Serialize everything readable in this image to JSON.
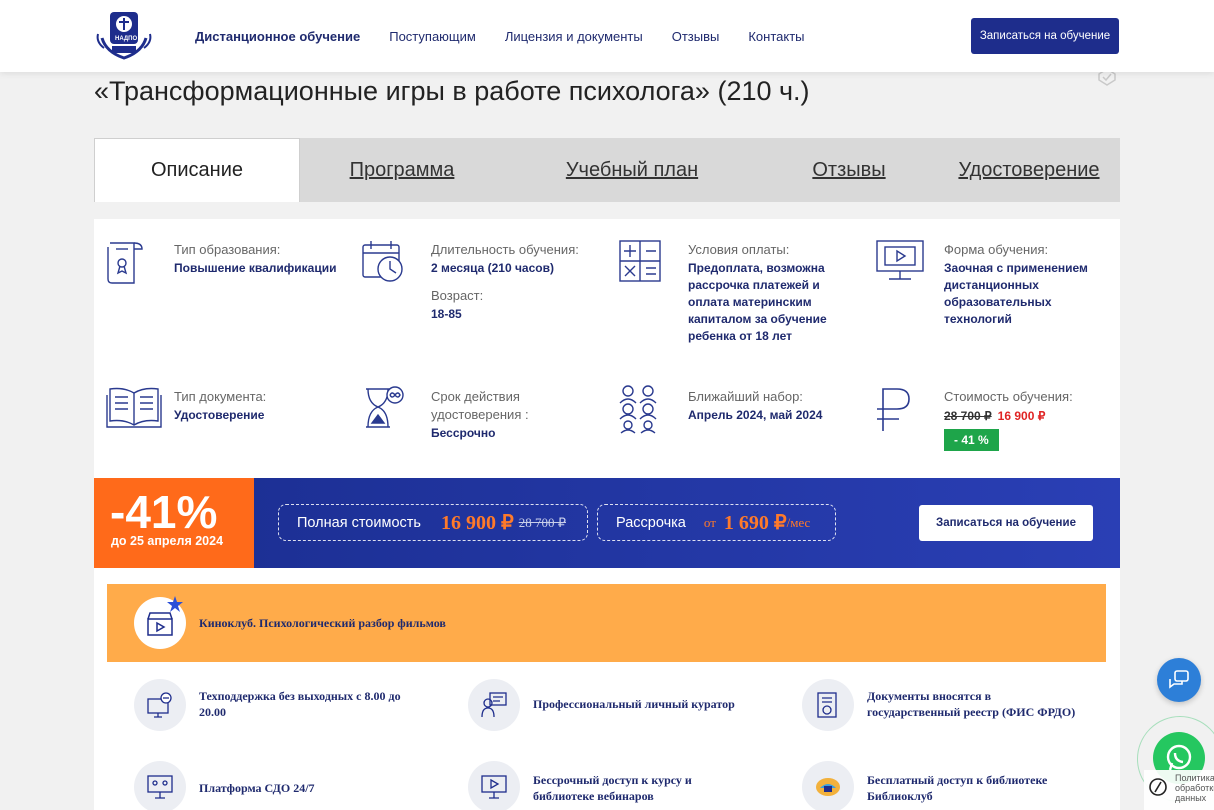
{
  "header": {
    "logo_text": "НАДПО",
    "nav": [
      {
        "label": "Дистанционное обучение",
        "active": true
      },
      {
        "label": "Поступающим",
        "active": false
      },
      {
        "label": "Лицензия и документы",
        "active": false
      },
      {
        "label": "Отзывы",
        "active": false
      },
      {
        "label": "Контакты",
        "active": false
      }
    ],
    "enroll_button": "Записаться на обучение"
  },
  "page_title": "«Трансформационные игры в работе психолога» (210 ч.)",
  "tabs": [
    {
      "label": "Описание",
      "active": true
    },
    {
      "label": "Программа",
      "active": false
    },
    {
      "label": "Учебный план",
      "active": false
    },
    {
      "label": "Отзывы",
      "active": false
    },
    {
      "label": "Удостоверение",
      "active": false
    }
  ],
  "info": {
    "education_type": {
      "label": "Тип образования:",
      "value": "Повышение квалификации",
      "icon": "diploma-icon"
    },
    "duration": {
      "label": "Длительность обучения:",
      "value": "2 месяца (210 часов)",
      "age_label": "Возраст:",
      "age_value": "18-85",
      "icon": "calendar-clock-icon"
    },
    "payment": {
      "label": "Условия оплаты:",
      "value": "Предоплата, возможна рассрочка платежей и оплата материнским капиталом за обучение ребенка от 18 лет",
      "icon": "calculator-icon"
    },
    "form": {
      "label": "Форма обучения:",
      "value": "Заочная с применением дистанционных образовательных технологий",
      "icon": "monitor-play-icon"
    },
    "doc_type": {
      "label": "Тип документа:",
      "value": "Удостоверение",
      "icon": "open-book-icon"
    },
    "validity": {
      "label": "Срок действия удостоверения :",
      "value": "Бессрочно",
      "icon": "hourglass-infinity-icon"
    },
    "enrollment": {
      "label": "Ближайший набор:",
      "value": "Апрель 2024, май 2024",
      "icon": "group-icon"
    },
    "cost": {
      "label": "Стоимость обучения:",
      "old": "28 700 ₽",
      "new": "16 900 ₽",
      "badge": "- 41 %",
      "icon": "ruble-icon"
    }
  },
  "banner": {
    "discount": "-41%",
    "until": "до 25 апреля 2024",
    "full_label": "Полная стоимость",
    "full_new": "16 900 ₽",
    "full_old": "28 700 ₽",
    "installment_label": "Рассрочка",
    "installment_from": "от",
    "installment_value": "1 690 ₽",
    "installment_unit": "/мес",
    "enroll_button": "Записаться на обучение"
  },
  "features": {
    "highlight": {
      "text": "Киноклуб. Психологический разбор фильмов",
      "icon": "film-clapper-icon"
    },
    "items": [
      {
        "text": "Техподдержка без выходных с 8.00 до 20.00",
        "icon": "support-chat-icon"
      },
      {
        "text": "Профессиональный личный куратор",
        "icon": "curator-icon"
      },
      {
        "text": "Документы вносятся в государственный реестр (ФИС ФРДО)",
        "icon": "document-icon"
      },
      {
        "text": "Платформа СДО 24/7",
        "icon": "platform-icon"
      },
      {
        "text": "Бессрочный доступ к курсу и библиотеке вебинаров",
        "icon": "video-library-icon"
      },
      {
        "text": "Бесплатный доступ к библиотеке Библиоклуб",
        "icon": "library-icon"
      }
    ]
  },
  "floating": {
    "privacy_text": "Политика обработки данных"
  },
  "colors": {
    "brand_navy": "#1e2d8c",
    "accent_orange": "#ff6a1a",
    "highlight_orange": "#ffab4a",
    "badge_green": "#1ea54a",
    "price_red": "#e02424"
  }
}
